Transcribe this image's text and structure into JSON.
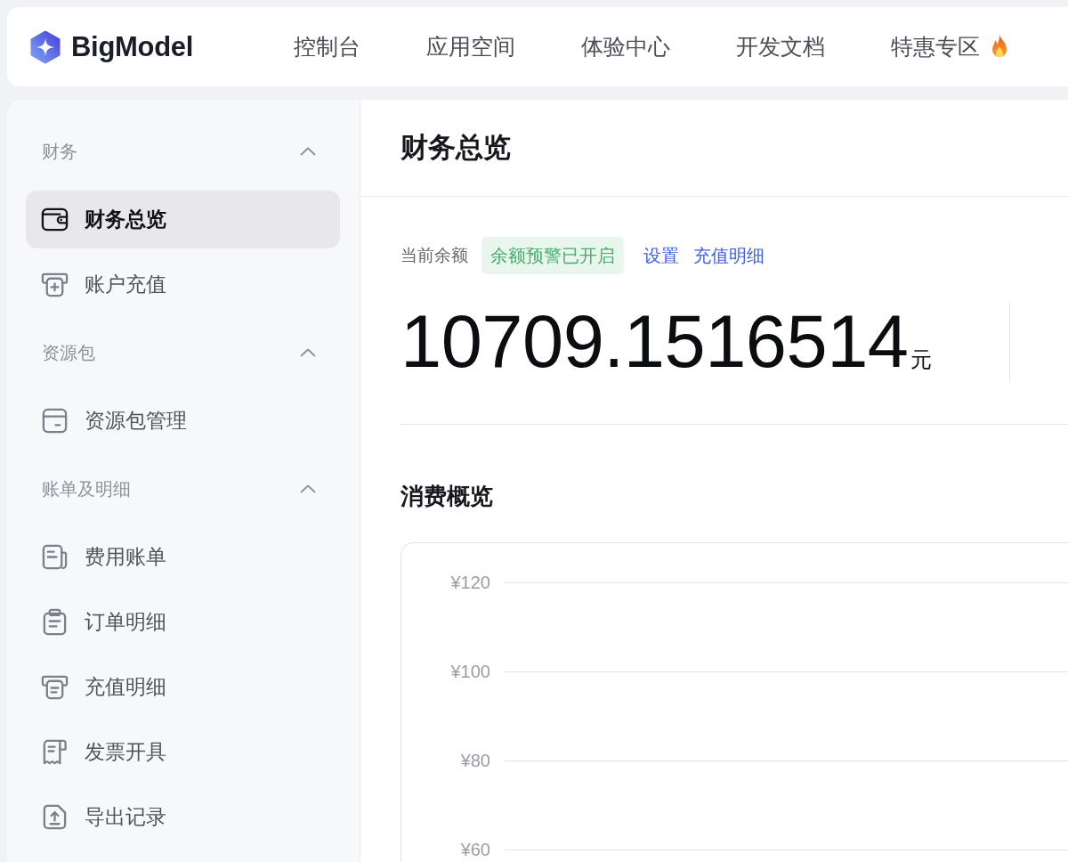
{
  "header": {
    "brand": "BigModel",
    "nav": [
      {
        "label": "控制台",
        "hot": false
      },
      {
        "label": "应用空间",
        "hot": false
      },
      {
        "label": "体验中心",
        "hot": false
      },
      {
        "label": "开发文档",
        "hot": false
      },
      {
        "label": "特惠专区",
        "hot": true
      }
    ]
  },
  "sidebar": {
    "groups": [
      {
        "title": "财务",
        "expanded": true,
        "items": [
          {
            "label": "财务总览",
            "selected": true
          },
          {
            "label": "账户充值",
            "selected": false
          }
        ]
      },
      {
        "title": "资源包",
        "expanded": true,
        "items": [
          {
            "label": "资源包管理",
            "selected": false
          }
        ]
      },
      {
        "title": "账单及明细",
        "expanded": true,
        "items": [
          {
            "label": "费用账单",
            "selected": false
          },
          {
            "label": "订单明细",
            "selected": false
          },
          {
            "label": "充值明细",
            "selected": false
          },
          {
            "label": "发票开具",
            "selected": false
          },
          {
            "label": "导出记录",
            "selected": false
          }
        ]
      }
    ]
  },
  "page": {
    "title": "财务总览"
  },
  "balance": {
    "label": "当前余额",
    "badge": "余额预警已开启",
    "links": [
      "设置",
      "充值明细"
    ],
    "amount": "10709.1516514",
    "unit": "元"
  },
  "consumption": {
    "title": "消费概览",
    "chart": {
      "y_axis_labels": [
        "¥120",
        "¥100",
        "¥80",
        "¥60"
      ]
    }
  }
}
